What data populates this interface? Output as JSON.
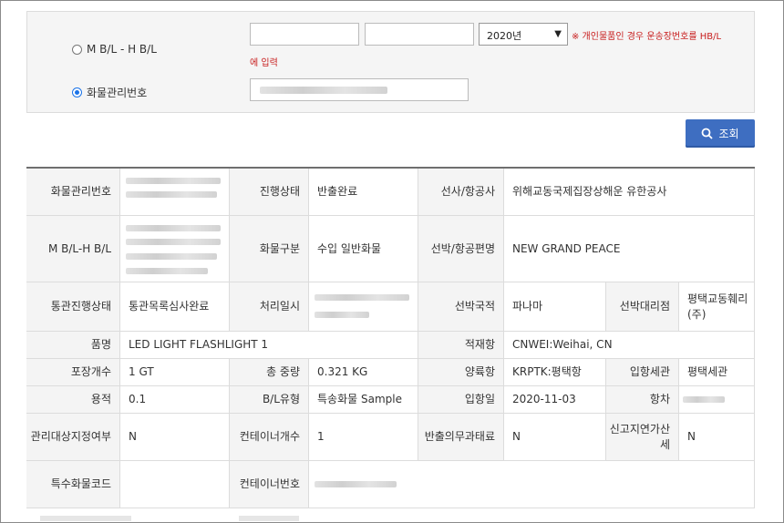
{
  "search": {
    "radio_mbl_label": "M B/L - H B/L",
    "radio_cargo_label": "화물관리번호",
    "year_value": "2020년",
    "notice_line1": "※ 개인물품인 경우 운송장번호를 HB/L",
    "notice_line2": "에 입력",
    "search_button_label": "조회"
  },
  "table": {
    "r1": {
      "h1": "화물관리번호",
      "h2": "진행상태",
      "v2": "반출완료",
      "h3": "선사/항공사",
      "v3": "위해교동국제집장상해운 유한공사"
    },
    "r2": {
      "h1": "M B/L-H B/L",
      "h2": "화물구분",
      "v2": "수입 일반화물",
      "h3": "선박/항공편명",
      "v3": "NEW GRAND PEACE"
    },
    "r3": {
      "h1": "통관진행상태",
      "v1": "통관목록심사완료",
      "h2": "처리일시",
      "h3": "선박국적",
      "v3": "파나마",
      "h4": "선박대리점",
      "v4": "평택교동훼리(주)"
    },
    "r4": {
      "h1": "품명",
      "v1": "LED LIGHT FLASHLIGHT 1",
      "h3": "적재항",
      "v3": "CNWEI:Weihai, CN"
    },
    "r5": {
      "h1": "포장개수",
      "v1": "1 GT",
      "h2": "총 중량",
      "v2": "0.321 KG",
      "h3": "양륙항",
      "v3": "KRPTK:평택항",
      "h4": "입항세관",
      "v4": "평택세관"
    },
    "r6": {
      "h1": "용적",
      "v1": "0.1",
      "h2": "B/L유형",
      "v2": "특송화물 Sample",
      "h3": "입항일",
      "v3": "2020-11-03",
      "h4": "항차"
    },
    "r7": {
      "h1": "관리대상지정여부",
      "v1": "N",
      "h2": "컨테이너개수",
      "v2": "1",
      "h3": "반출의무과태료",
      "v3": "N",
      "h4": "신고지연가산세",
      "v4": "N"
    },
    "r8": {
      "h1": "특수화물코드",
      "h2": "컨테이너번호"
    }
  },
  "colors": {
    "accent": "#3e6ec1",
    "notice": "#c81e1e",
    "header_bg": "#f4f4f4"
  },
  "icons": [
    "search-icon",
    "chevron-down-icon"
  ]
}
